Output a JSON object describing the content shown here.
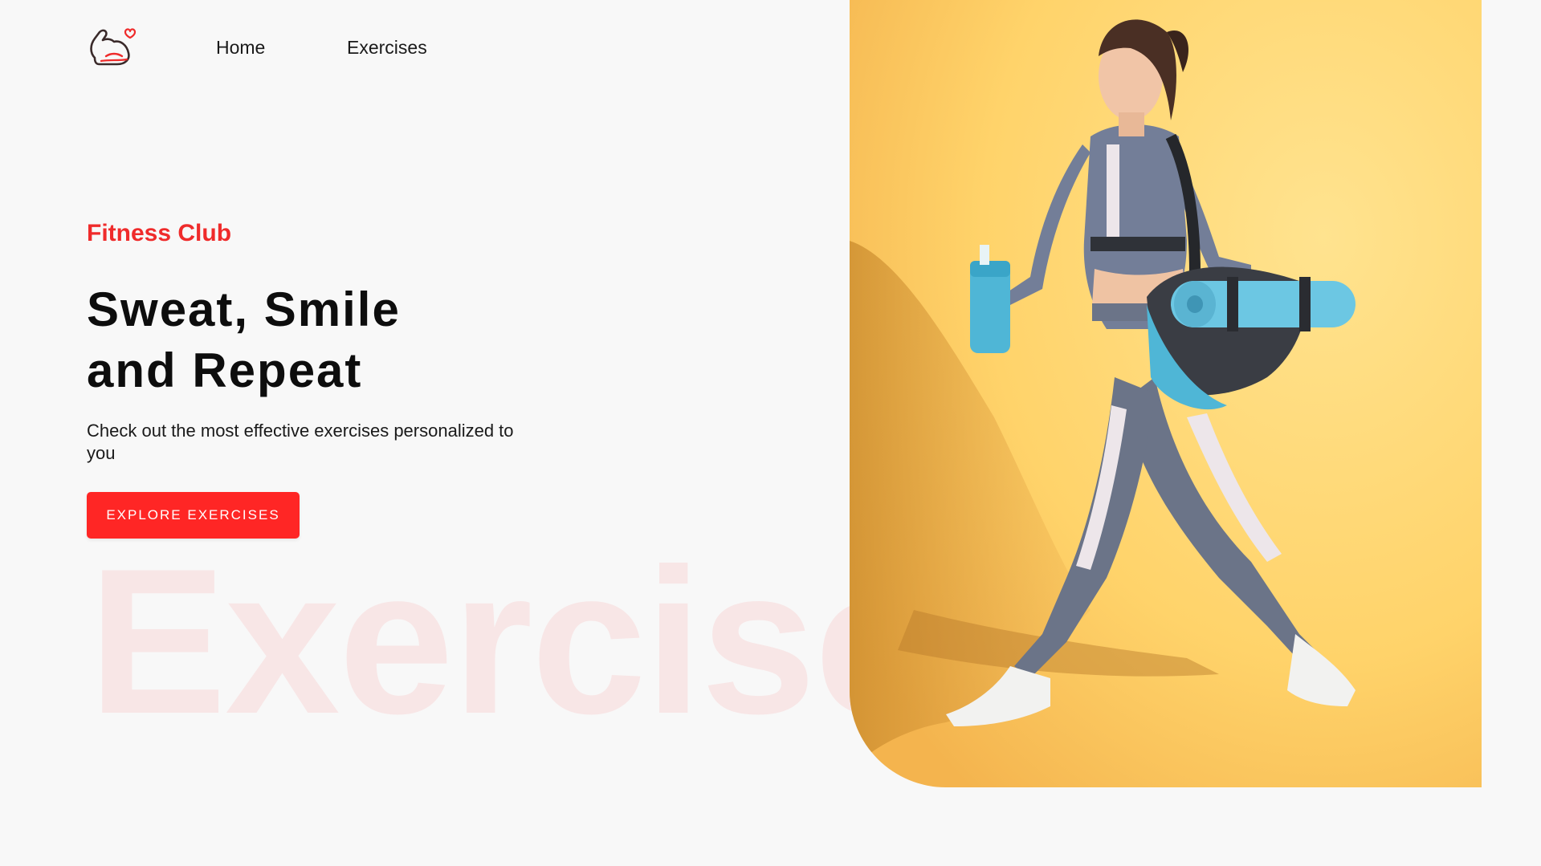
{
  "nav": {
    "logo_icon": "flexed-bicep-heart-icon",
    "links": [
      {
        "label": "Home"
      },
      {
        "label": "Exercises"
      }
    ]
  },
  "hero": {
    "eyebrow": "Fitness Club",
    "headline_line1": "Sweat, Smile",
    "headline_line2": "and Repeat",
    "subtext": "Check out the most effective exercises personalized to you",
    "cta_label": "EXPLORE EXERCISES",
    "watermark": "Exercise"
  },
  "colors": {
    "accent": "#ff2625",
    "background": "#f8f8f8",
    "image_background": "#ffd26b"
  }
}
